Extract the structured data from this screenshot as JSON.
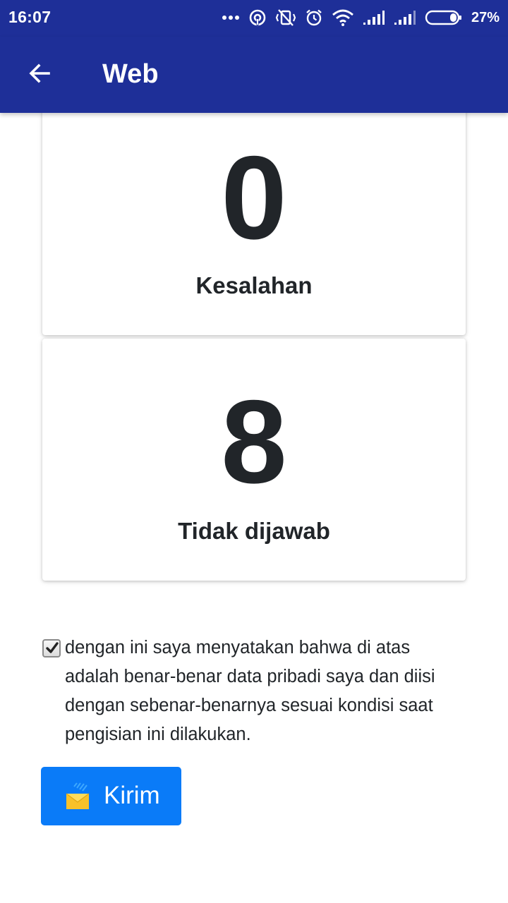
{
  "status_bar": {
    "time": "16:07",
    "battery": "27%",
    "icons": [
      "more-dots-icon",
      "hotspot-icon",
      "vibrate-icon",
      "alarm-icon",
      "wifi-icon",
      "signal-icon",
      "signal-icon",
      "battery-icon"
    ]
  },
  "app_bar": {
    "title": "Web",
    "back_icon": "arrow-left-icon"
  },
  "cards": [
    {
      "value": "0",
      "label": "Kesalahan"
    },
    {
      "value": "8",
      "label": "Tidak dijawab"
    }
  ],
  "agreement": {
    "checked": true,
    "text": "dengan ini saya menyatakan bahwa di atas adalah benar-benar data pribadi saya dan diisi dengan sebenar-benarnya sesuai kondisi saat pengisian ini dilakukan."
  },
  "send_button": {
    "label": "Kirim",
    "icon": "mail-send-icon"
  },
  "colors": {
    "app_bar": "#1e2f98",
    "primary_button": "#0a7bf8",
    "text": "#212529"
  }
}
